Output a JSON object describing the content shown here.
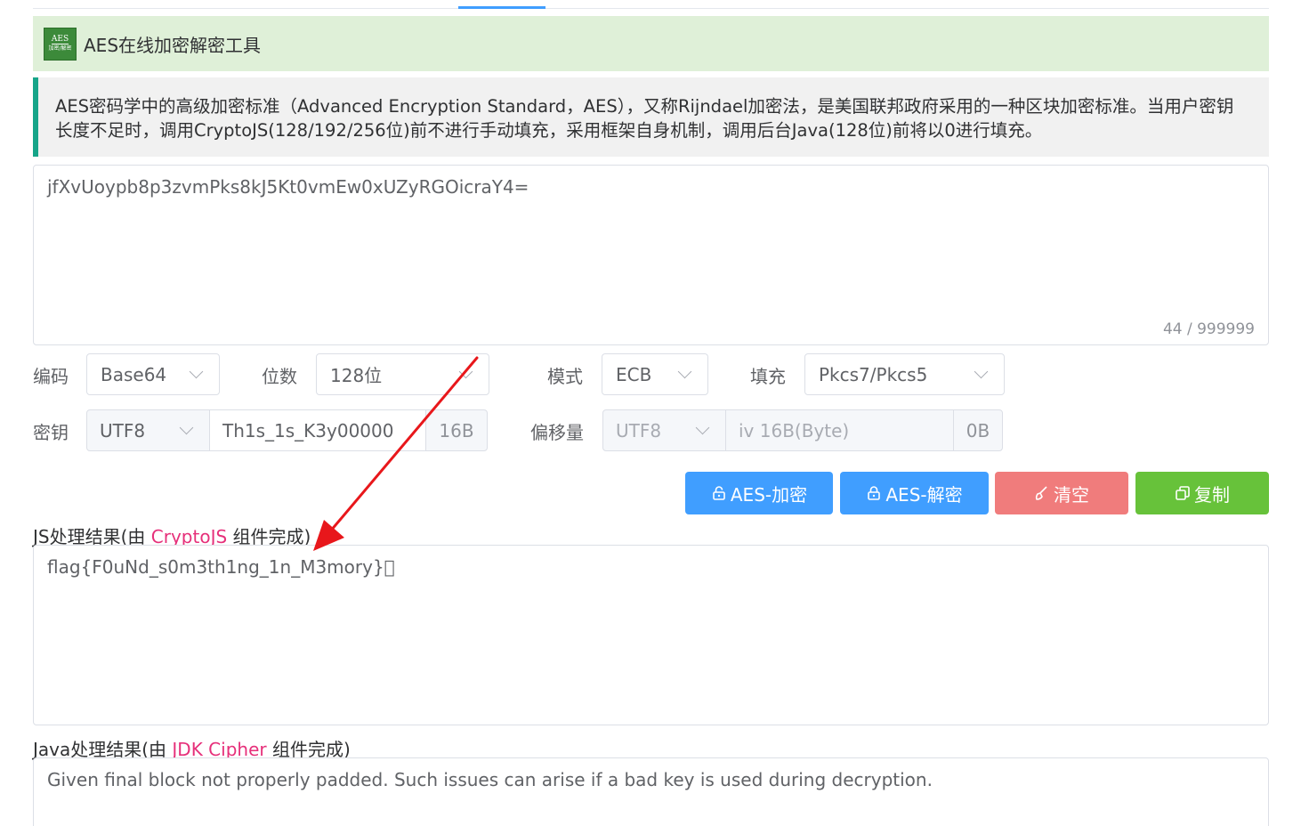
{
  "header": {
    "title": "AES在线加密解密工具",
    "logo_line1": "AES",
    "logo_line2": "加密/解密"
  },
  "notice": {
    "text": "AES密码学中的高级加密标准（Advanced Encryption Standard，AES），又称Rijndael加密法，是美国联邦政府采用的一种区块加密标准。当用户密钥长度不足时，调用CryptoJS(128/192/256位)前不进行手动填充，采用框架自身机制，调用后台Java(128位)前将以0进行填充。"
  },
  "input": {
    "value": "jfXvUoypb8p3zvmPks8kJ5Kt0vmEw0xUZyRGOicraY4=",
    "counter": "44 / 999999"
  },
  "options": {
    "encoding_label": "编码",
    "encoding_value": "Base64",
    "bits_label": "位数",
    "bits_value": "128位",
    "mode_label": "模式",
    "mode_value": "ECB",
    "padding_label": "填充",
    "padding_value": "Pkcs7/Pkcs5"
  },
  "key": {
    "label": "密钥",
    "charset": "UTF8",
    "value": "Th1s_1s_K3y00000",
    "size": "16B"
  },
  "iv": {
    "label": "偏移量",
    "charset": "UTF8",
    "placeholder": "iv 16B(Byte)",
    "size": "0B"
  },
  "buttons": {
    "encrypt": "AES-加密",
    "decrypt": "AES-解密",
    "clear": "清空",
    "copy": "复制"
  },
  "js_result": {
    "label_prefix": "JS处理结果(由 ",
    "label_component": "CryptoJS",
    "label_suffix": " 组件完成)",
    "value": "flag{F0uNd_s0m3th1ng_1n_M3mory}\u0000"
  },
  "java_result": {
    "label_prefix": "Java处理结果(由 ",
    "label_component": "JDK Cipher",
    "label_suffix": " 组件完成)",
    "value": "Given final block not properly padded. Such issues can arise if a bad key is used during decryption."
  },
  "colors": {
    "primary": "#409eff",
    "danger": "#f07c7c",
    "success": "#67c23a",
    "highlight": "#e6307a",
    "annotation_arrow": "#e8171b"
  }
}
